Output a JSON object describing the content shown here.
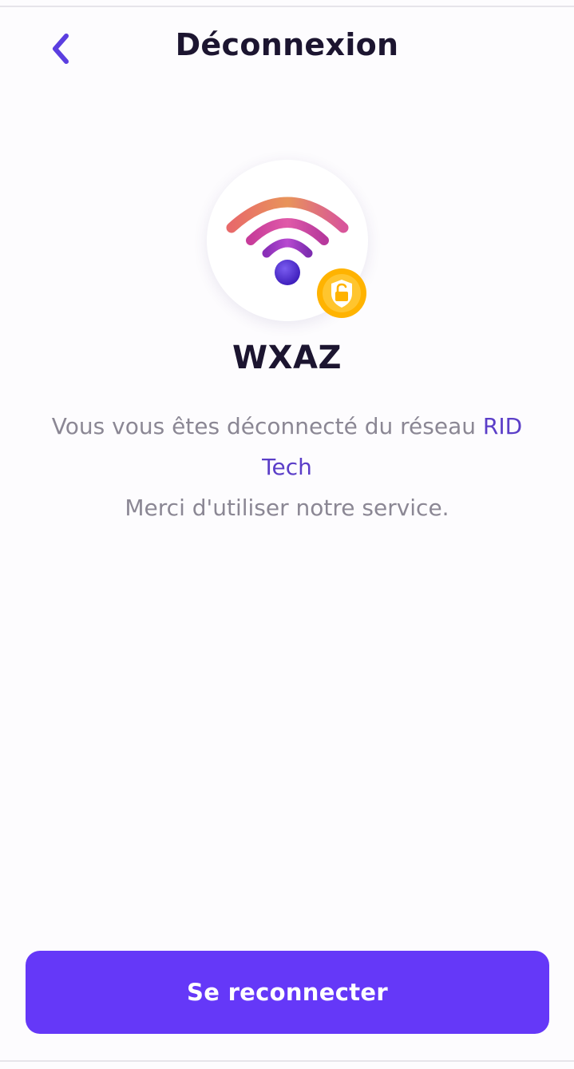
{
  "header": {
    "back_icon": "chevron-left-icon",
    "title": "Déconnexion"
  },
  "hero": {
    "icon": "wifi-icon",
    "badge_icon": "lock-open-shield-icon"
  },
  "network": {
    "name": "WXAZ"
  },
  "message": {
    "line1_prefix": "Vous vous êtes déconnecté du réseau",
    "provider": "RID Tech",
    "line2": "Merci d'utiliser notre service."
  },
  "actions": {
    "reconnect_label": "Se reconnecter"
  },
  "colors": {
    "primary": "#6538f8",
    "accent_text": "#5b3ec8",
    "title": "#1c1530",
    "muted_text": "#8b8794",
    "badge": "#ffb300"
  }
}
